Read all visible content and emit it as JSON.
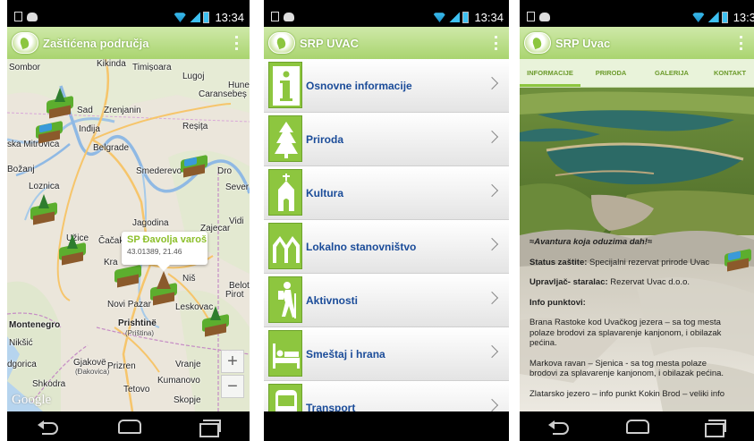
{
  "screens": [
    {
      "status": {
        "time": "13:34"
      },
      "appbar": {
        "title": "Zaštićena područja"
      },
      "map": {
        "cities": [
          {
            "name": "Sombor",
            "class": ""
          },
          {
            "name": "Kikinda",
            "class": ""
          },
          {
            "name": "Timișoara",
            "class": ""
          },
          {
            "name": "Lugoj",
            "class": ""
          },
          {
            "name": "Huned",
            "class": ""
          },
          {
            "name": "Caransebeș",
            "class": ""
          },
          {
            "name": "Sad",
            "class": ""
          },
          {
            "name": "Zrenjanin",
            "class": ""
          },
          {
            "name": "Reșița",
            "class": ""
          },
          {
            "name": "Inđija",
            "class": ""
          },
          {
            "name": "ska Mitrovica",
            "class": ""
          },
          {
            "name": "Belgrade",
            "class": ""
          },
          {
            "name": "Smederevo",
            "class": ""
          },
          {
            "name": "Dro",
            "class": ""
          },
          {
            "name": "Božanj",
            "class": ""
          },
          {
            "name": "Loznica",
            "class": ""
          },
          {
            "name": "Sever",
            "class": ""
          },
          {
            "name": "Jagodina",
            "class": ""
          },
          {
            "name": "Zajecar",
            "class": ""
          },
          {
            "name": "Vidi",
            "class": ""
          },
          {
            "name": "Užice",
            "class": ""
          },
          {
            "name": "Čačak",
            "class": ""
          },
          {
            "name": "Kra",
            "class": ""
          },
          {
            "name": "Niš",
            "class": ""
          },
          {
            "name": "Beloti",
            "class": ""
          },
          {
            "name": "Pirot",
            "class": ""
          },
          {
            "name": "Novi Pazar",
            "class": ""
          },
          {
            "name": "Leskovac",
            "class": ""
          },
          {
            "name": "Montenegro",
            "class": "big"
          },
          {
            "name": "Prishtinë",
            "class": "big"
          },
          {
            "name": "(Priština)",
            "class": "sub"
          },
          {
            "name": "Nikšić",
            "class": ""
          },
          {
            "name": "dgorica",
            "class": ""
          },
          {
            "name": "Gjakovë",
            "class": ""
          },
          {
            "name": "(Đakovica)",
            "class": "sub"
          },
          {
            "name": "Prizren",
            "class": ""
          },
          {
            "name": "Vranje",
            "class": ""
          },
          {
            "name": "Kumanovo",
            "class": ""
          },
          {
            "name": "Shkodra",
            "class": ""
          },
          {
            "name": "Tetovo",
            "class": ""
          },
          {
            "name": "Skopje",
            "class": ""
          }
        ],
        "callout": {
          "title": "SP Đavolja varoš",
          "coords": "43.01389, 21.46"
        },
        "zoom_in": "+",
        "zoom_out": "−",
        "attribution": "Google"
      }
    },
    {
      "status": {
        "time": "13:34"
      },
      "appbar": {
        "title": "SRP UVAC"
      },
      "menu": [
        {
          "label": "Osnovne informacije",
          "icon": "info-icon"
        },
        {
          "label": "Priroda",
          "icon": "tree-icon"
        },
        {
          "label": "Kultura",
          "icon": "church-icon"
        },
        {
          "label": "Lokalno stanovništvo",
          "icon": "people-icon"
        },
        {
          "label": "Aktivnosti",
          "icon": "hiker-icon"
        },
        {
          "label": "Smeštaj i hrana",
          "icon": "bed-icon"
        },
        {
          "label": "Transport",
          "icon": "bus-icon"
        }
      ]
    },
    {
      "status": {
        "time": "13:3"
      },
      "appbar": {
        "title": "SRP Uvac"
      },
      "tabs": [
        "INFORMACIJE",
        "PRIRODA",
        "GALERIJA",
        "KONTAKT"
      ],
      "content": {
        "tagline": "≈Avantura koja oduzima dah!≈",
        "status_label": "Status zaštite:",
        "status_value": " Specijalni rezervat prirode Uvac",
        "manager_label": "Upravljač- staralac:",
        "manager_value": " Rezervat Uvac d.o.o.",
        "info_heading": "Info punktovi:",
        "p1": "Brana Rastoke kod Uvačkog jezera – sa tog mesta polaze brodovi za splavarenje kanjonom, i obilazak pećina.",
        "p2": "Markova ravan – Sjenica - sa tog mesta polaze brodovi za splavarenje kanjonom, i obilazak pećina.",
        "p3": "Zlatarsko jezero – info punkt Kokin Brod – veliki info"
      }
    }
  ],
  "colors": {
    "accent": "#8dc63f",
    "link_blue": "#1b4c99",
    "callout_green": "#8cbf2a"
  }
}
